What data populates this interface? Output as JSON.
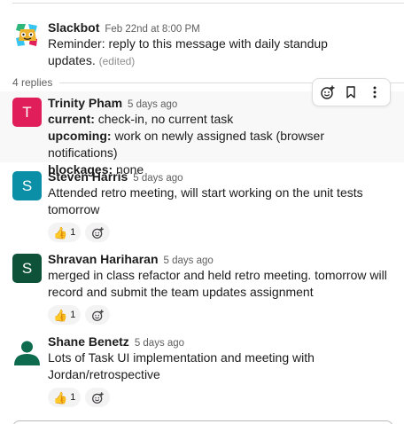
{
  "thread": {
    "parent": {
      "author": "Slackbot",
      "time": "Feb 22nd at 8:00 PM",
      "text_line1": "Reminder: reply to this message with daily standup",
      "text_line2": "updates.",
      "edited": "(edited)"
    },
    "replies_label": "4 replies",
    "replies": [
      {
        "author": "Trinity Pham",
        "time": "5 days ago",
        "avatar_letter": "T",
        "avatar_color": "#e01e5a",
        "lines": [
          {
            "label": "current:",
            "text": "check-in, no current task"
          },
          {
            "label": "upcoming:",
            "text": "work on newly assigned task (browser notifications)"
          },
          {
            "label": "blockages:",
            "text": "none"
          }
        ]
      },
      {
        "author": "Steven Harris",
        "time": "5 days ago",
        "avatar_letter": "S",
        "avatar_color": "#0b8fa6",
        "text_line1": "Attended retro meeting, will start working on the unit tests",
        "text_line2": "tomorrow",
        "reaction_emoji": "👍",
        "reaction_count": "1"
      },
      {
        "author": "Shravan Hariharan",
        "time": "5 days ago",
        "avatar_letter": "S",
        "avatar_color": "#0e5239",
        "text_line1": "merged in class refactor and held retro meeting. tomorrow will",
        "text_line2": "record and submit the team updates assignment",
        "reaction_emoji": "👍",
        "reaction_count": "1"
      },
      {
        "author": "Shane Benetz",
        "time": "5 days ago",
        "avatar_icon": "person-icon",
        "avatar_color": "#0e6b4d",
        "text_line1": "Lots of Task UI implementation and meeting with",
        "text_line2": "Jordan/retrospective",
        "reaction_emoji": "👍",
        "reaction_count": "1"
      }
    ]
  },
  "toolbar": {
    "icons": [
      "add-reaction-icon",
      "bookmark-icon",
      "more-actions-icon"
    ]
  },
  "colors": {
    "text": "#1d1c1d",
    "meta": "#616061",
    "hover_bg": "#f8f8f8",
    "reaction_bg": "#f3f3f3"
  }
}
